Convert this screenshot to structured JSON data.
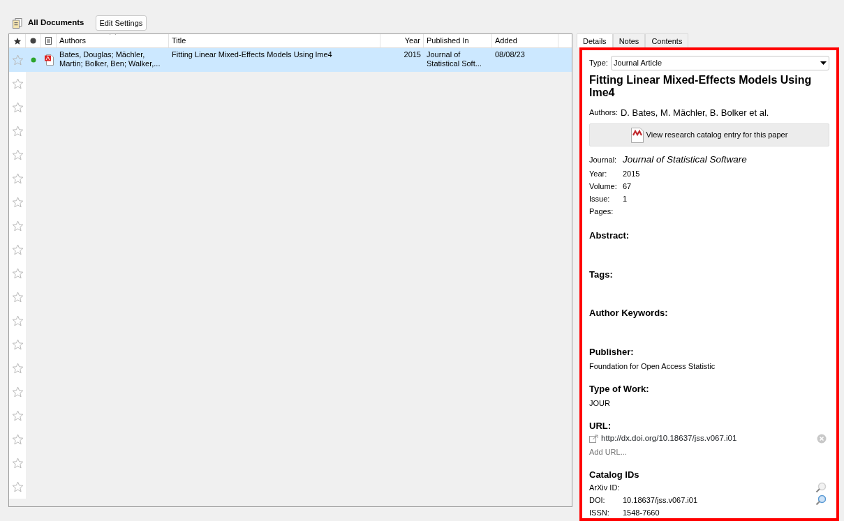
{
  "toolbar": {
    "collection": "All Documents",
    "button": "Edit Settings"
  },
  "table": {
    "columns": [
      {
        "kind": "star"
      },
      {
        "kind": "dot"
      },
      {
        "kind": "file"
      },
      {
        "kind": "text",
        "label": "Authors",
        "sorted": true
      },
      {
        "kind": "text",
        "label": "Title",
        "sorted": false
      },
      {
        "kind": "text",
        "label": "Year",
        "sorted": false
      },
      {
        "kind": "text",
        "label": "Published In",
        "sorted": false
      },
      {
        "kind": "text",
        "label": "Added",
        "sorted": false
      }
    ],
    "rows": [
      {
        "starred": false,
        "unread": true,
        "has_pdf": true,
        "selected": true,
        "authors": "Bates, Douglas; Mächler, Martin; Bolker, Ben; Walker,...",
        "title": "Fitting Linear Mixed-Effects Models Using lme4",
        "year": "2015",
        "published_in": "Journal of Statistical Soft...",
        "added": "08/08/23"
      }
    ],
    "empty_rows": [
      {
        "starred": false
      },
      {
        "starred": false
      },
      {
        "starred": false
      },
      {
        "starred": false
      },
      {
        "starred": false
      },
      {
        "starred": false
      },
      {
        "starred": false
      },
      {
        "starred": false
      },
      {
        "starred": false
      },
      {
        "starred": false
      },
      {
        "starred": false
      },
      {
        "starred": false
      },
      {
        "starred": false
      },
      {
        "starred": false
      },
      {
        "starred": false
      },
      {
        "starred": false
      },
      {
        "starred": false
      },
      {
        "starred": false
      }
    ]
  },
  "tabs": [
    {
      "label": "Details",
      "selected": true
    },
    {
      "label": "Notes",
      "selected": false
    },
    {
      "label": "Contents",
      "selected": false
    }
  ],
  "details": {
    "highlighted": true,
    "type": {
      "label": "Type:",
      "value": "Journal Article"
    },
    "title": "Fitting Linear Mixed-Effects Models Using lme4",
    "authors": {
      "label": "Authors:",
      "value": "D. Bates, M. Mächler, B. Bolker et al."
    },
    "catalog_button": "View research catalog entry for this paper",
    "fields": [
      {
        "label": "Journal:",
        "value": "Journal of Statistical Software",
        "kind": "journal"
      },
      {
        "label": "Year:",
        "value": "2015",
        "kind": "plain"
      },
      {
        "label": "Volume:",
        "value": "67",
        "kind": "plain"
      },
      {
        "label": "Issue:",
        "value": "1",
        "kind": "plain"
      },
      {
        "label": "Pages:",
        "kind": "plain"
      }
    ],
    "sections": [
      {
        "heading": "Abstract:"
      },
      {
        "heading": "Tags:"
      },
      {
        "heading": "Author Keywords:"
      },
      {
        "heading": "Publisher:",
        "value": "Foundation for Open Access Statistic"
      },
      {
        "heading": "Type of Work:",
        "value": "JOUR"
      }
    ],
    "url": {
      "heading": "URL:",
      "value": "http://dx.doi.org/10.18637/jss.v067.i01",
      "placeholder": "Add URL..."
    },
    "catalog_ids": {
      "heading": "Catalog IDs",
      "items": [
        {
          "label": "ArXiv ID:",
          "lookup_enabled": false
        },
        {
          "label": "DOI:",
          "value": "10.18637/jss.v067.i01",
          "lookup_enabled": true
        },
        {
          "label": "ISSN:",
          "value": "1548-7660"
        }
      ]
    }
  }
}
